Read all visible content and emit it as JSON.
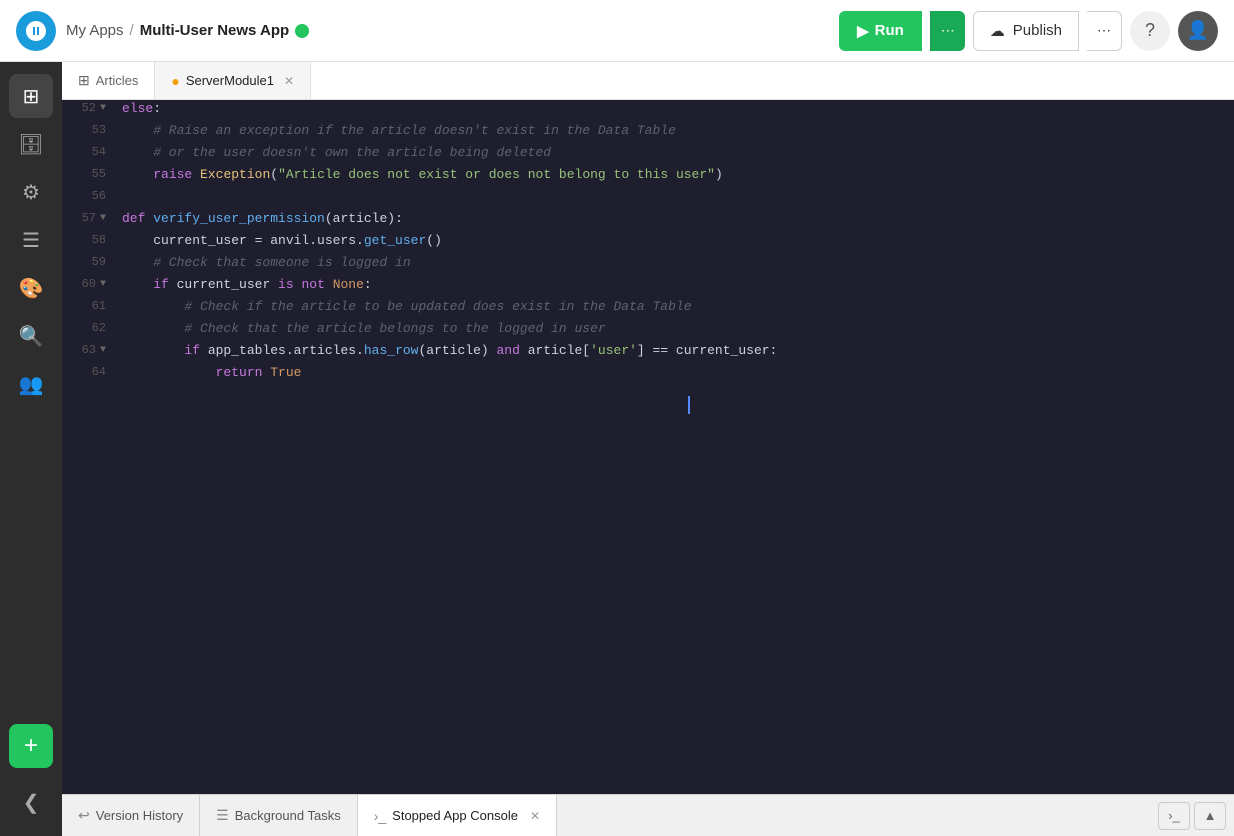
{
  "header": {
    "breadcrumb_my_apps": "My Apps",
    "breadcrumb_sep": "/",
    "app_name": "Multi-User News App",
    "run_label": "Run",
    "publish_label": "Publish"
  },
  "tabs": [
    {
      "id": "articles",
      "label": "Articles",
      "icon": "grid",
      "active": false,
      "closable": false
    },
    {
      "id": "server_module",
      "label": "ServerModule1",
      "icon": "circle",
      "active": true,
      "closable": true
    }
  ],
  "code": {
    "lines": [
      {
        "num": 52,
        "arrow": true,
        "content": "else:"
      },
      {
        "num": 53,
        "arrow": false,
        "content": "    # Raise an exception if the article doesn't exist in the Data Table"
      },
      {
        "num": 54,
        "arrow": false,
        "content": "    # or the user doesn't own the article being deleted"
      },
      {
        "num": 55,
        "arrow": false,
        "content": "    raise Exception(\"Article does not exist or does not belong to this user\")"
      },
      {
        "num": 56,
        "arrow": false,
        "content": ""
      },
      {
        "num": 57,
        "arrow": true,
        "content": "def verify_user_permission(article):"
      },
      {
        "num": 58,
        "arrow": false,
        "content": "    current_user = anvil.users.get_user()"
      },
      {
        "num": 59,
        "arrow": false,
        "content": "    # Check that someone is logged in"
      },
      {
        "num": 60,
        "arrow": true,
        "content": "    if current_user is not None:"
      },
      {
        "num": 61,
        "arrow": false,
        "content": "        # Check if the article to be updated does exist in the Data Table"
      },
      {
        "num": 62,
        "arrow": false,
        "content": "        # Check that the article belongs to the logged in user"
      },
      {
        "num": 63,
        "arrow": true,
        "content": "        if app_tables.articles.has_row(article) and article['user'] == current_user:"
      },
      {
        "num": 64,
        "arrow": false,
        "content": "            return True"
      }
    ]
  },
  "bottom_tabs": [
    {
      "id": "version_history",
      "label": "Version History",
      "icon": "history",
      "active": false
    },
    {
      "id": "background_tasks",
      "label": "Background Tasks",
      "icon": "tasks",
      "active": false
    },
    {
      "id": "stopped_app_console",
      "label": "Stopped App Console",
      "icon": "terminal",
      "active": true,
      "closable": true
    }
  ],
  "sidebar_icons": [
    {
      "id": "grid",
      "icon": "⊞",
      "active": true
    },
    {
      "id": "database",
      "icon": "🗄",
      "active": false
    },
    {
      "id": "settings",
      "icon": "⚙",
      "active": false
    },
    {
      "id": "list",
      "icon": "☰",
      "active": false
    },
    {
      "id": "palette",
      "icon": "🎨",
      "active": false
    },
    {
      "id": "search",
      "icon": "🔍",
      "active": false
    },
    {
      "id": "users",
      "icon": "👥",
      "active": false
    }
  ]
}
